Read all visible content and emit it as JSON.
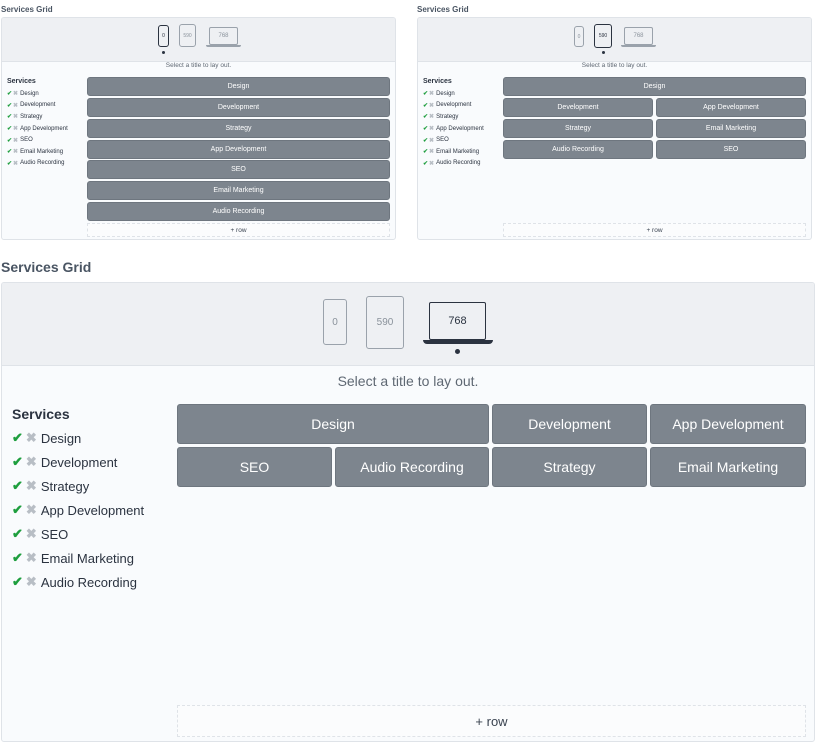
{
  "section_title": "Services Grid",
  "devices": {
    "phone": "0",
    "tablet": "590",
    "laptop": "768"
  },
  "hint": "Select a title to lay out.",
  "services_title": "Services",
  "services": [
    "Design",
    "Development",
    "Strategy",
    "App Development",
    "SEO",
    "Email Marketing",
    "Audio Recording"
  ],
  "add_row": "+ row",
  "grid_phone": [
    "Design",
    "Development",
    "Strategy",
    "App Development",
    "SEO",
    "Email Marketing",
    "Audio Recording"
  ],
  "grid_tablet": [
    "Design",
    "Development",
    "App Development",
    "Strategy",
    "Email Marketing",
    "Audio Recording",
    "SEO"
  ],
  "grid_laptop": [
    "Design",
    "Development",
    "App Development",
    "SEO",
    "Audio Recording",
    "Strategy",
    "Email Marketing"
  ],
  "colors": {
    "tile": "#7d858e",
    "check": "#1e9e3e",
    "cross": "#b8bec5",
    "active_device": "#2b3340"
  },
  "icons": {
    "check": "check-icon",
    "cross": "close-icon"
  }
}
